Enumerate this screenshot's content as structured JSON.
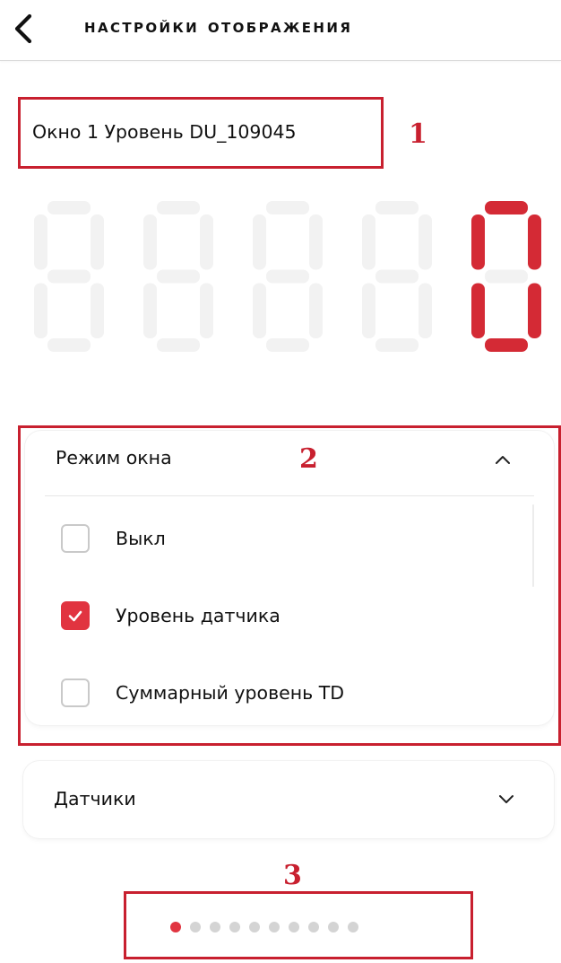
{
  "header": {
    "title": "Настройки отображения",
    "back_icon": "chevron-left-icon"
  },
  "window": {
    "name": "Окно 1 Уровень DU_109045"
  },
  "display": {
    "digits": [
      "",
      "",
      "",
      "",
      "0"
    ],
    "active_color": "#d42a35",
    "inactive_color": "#f2f2f2"
  },
  "mode_panel": {
    "title": "Режим окна",
    "expanded": true,
    "chevron_icon": "chevron-up-icon",
    "options": [
      {
        "label": "Выкл",
        "checked": false
      },
      {
        "label": "Уровень датчика",
        "checked": true
      },
      {
        "label": "Суммарный уровень TD",
        "checked": false
      }
    ]
  },
  "sensors_panel": {
    "title": "Датчики",
    "expanded": false,
    "chevron_icon": "chevron-down-icon"
  },
  "pager": {
    "count": 10,
    "active_index": 0
  },
  "annotations": {
    "label_1": "1",
    "label_2": "2",
    "label_3": "3",
    "color": "#c8202f"
  }
}
